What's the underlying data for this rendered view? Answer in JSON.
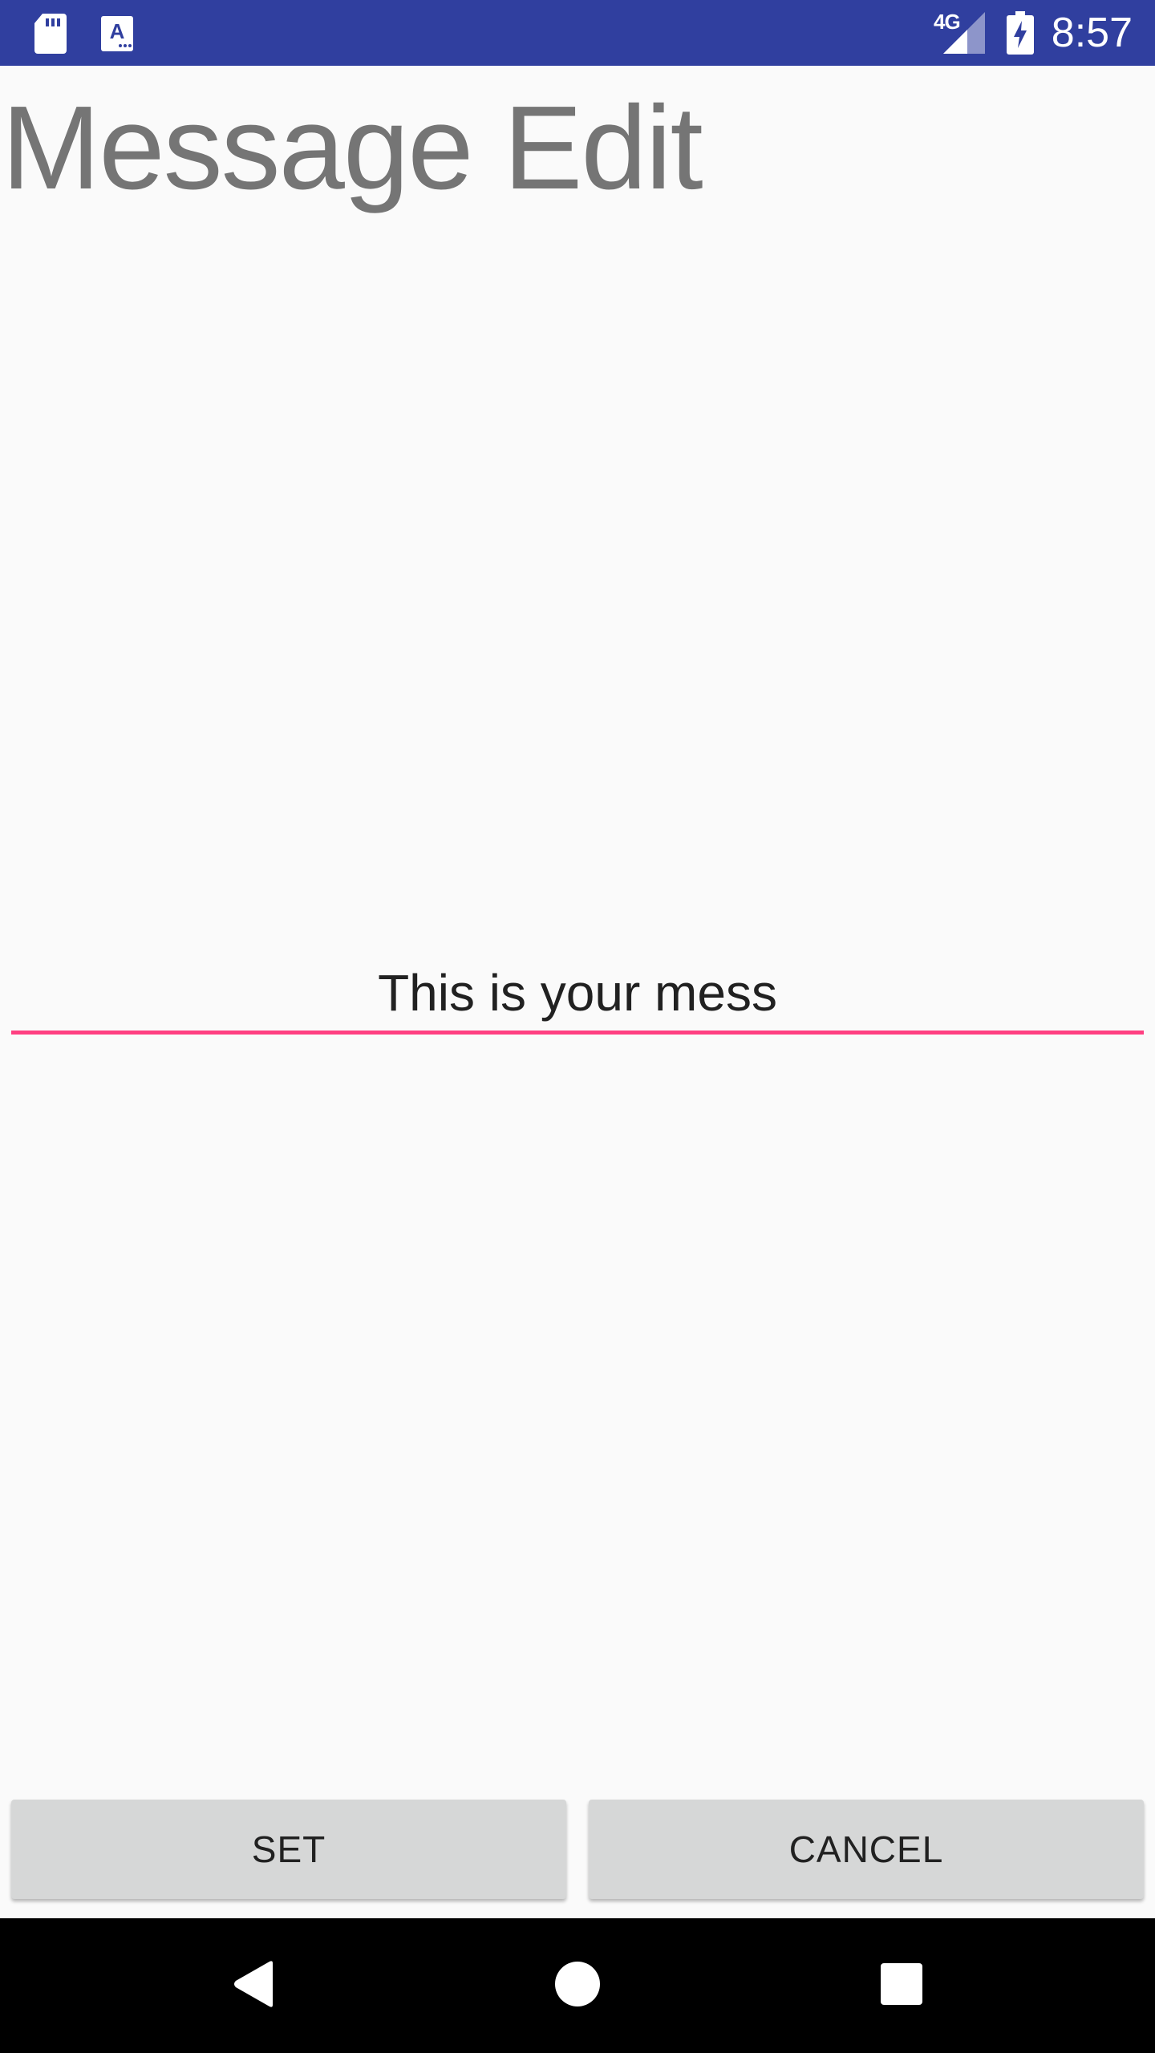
{
  "status_bar": {
    "network": "4G",
    "time": "8:57",
    "icons": [
      "sd-card-icon",
      "keyboard-a-icon",
      "signal-icon",
      "battery-charging-icon"
    ]
  },
  "title": "Message Edit",
  "edit_field": {
    "value": "This is your mess"
  },
  "buttons": {
    "set_label": "SET",
    "cancel_label": "CANCEL"
  },
  "nav_bar": {
    "icons": [
      "back-icon",
      "home-icon",
      "recents-icon"
    ]
  },
  "colors": {
    "status_bar": "#303f9f",
    "accent": "#ff4081",
    "background": "#fafafa",
    "button": "#d6d7d7",
    "title_text": "#757575"
  }
}
